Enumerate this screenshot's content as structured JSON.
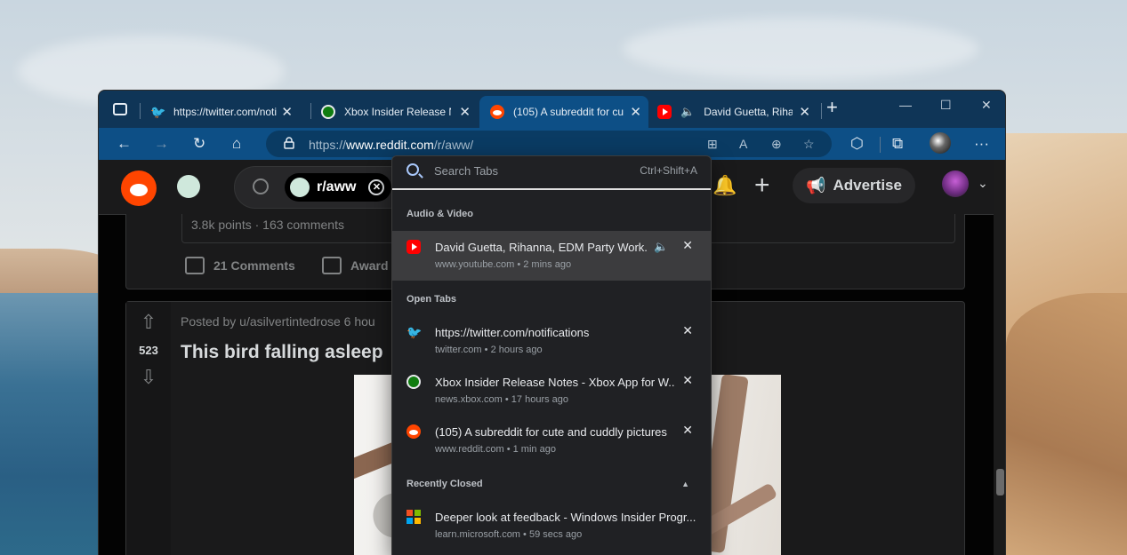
{
  "browser": {
    "tabs": [
      {
        "title": "https://twitter.com/noti",
        "favicon": "twitter-icon",
        "active": false
      },
      {
        "title": "Xbox Insider Release Not",
        "favicon": "xbox-icon",
        "active": false
      },
      {
        "title": "(105) A subreddit for cu",
        "favicon": "reddit-icon",
        "active": true
      },
      {
        "title": "David Guetta, Rihan",
        "favicon": "youtube-icon",
        "active": false,
        "playing_audio": true
      }
    ],
    "new_tab": "+",
    "window_controls": {
      "minimize": "—",
      "maximize": "☐",
      "close": "✕"
    },
    "url_prefix": "https://",
    "url_domain": "www.reddit.com",
    "url_path": "/r/aww/",
    "toolbar_more": "···"
  },
  "reddit": {
    "subreddit_chip": "r/aww",
    "advertise": "Advertise",
    "post1": {
      "stats": "3.8k points · 163 comments",
      "comments": "21 Comments",
      "award": "Award"
    },
    "post2": {
      "score": "523",
      "posted_by": "Posted by u/asilvertintedrose 6 hou",
      "title": "This bird falling asleep"
    }
  },
  "tab_search": {
    "placeholder": "Search Tabs",
    "shortcut": "Ctrl+Shift+A",
    "sections": {
      "audio_video": "Audio & Video",
      "open_tabs": "Open Tabs",
      "recently_closed": "Recently Closed"
    },
    "audio_items": [
      {
        "title": "David Guetta, Rihanna, EDM Party Work...",
        "domain": "www.youtube.com",
        "time": "2 mins ago",
        "icon": "youtube-icon"
      }
    ],
    "open_items": [
      {
        "title": "https://twitter.com/notifications",
        "domain": "twitter.com",
        "time": "2 hours ago",
        "icon": "twitter-icon"
      },
      {
        "title": "Xbox Insider Release Notes - Xbox App for W...",
        "domain": "news.xbox.com",
        "time": "17 hours ago",
        "icon": "xbox-icon"
      },
      {
        "title": "(105) A subreddit for cute and cuddly pictures",
        "domain": "www.reddit.com",
        "time": "1 min ago",
        "icon": "reddit-icon"
      }
    ],
    "closed_items": [
      {
        "title": "Deeper look at feedback - Windows Insider Progr...",
        "domain": "learn.microsoft.com",
        "time": "59 secs ago",
        "icon": "microsoft-icon"
      }
    ],
    "separator": "•"
  },
  "colors": {
    "tabstrip": "#0f3557",
    "toolbar": "#0d4f86",
    "flyout_bg": "#202124",
    "reddit_orange": "#ff4500"
  }
}
